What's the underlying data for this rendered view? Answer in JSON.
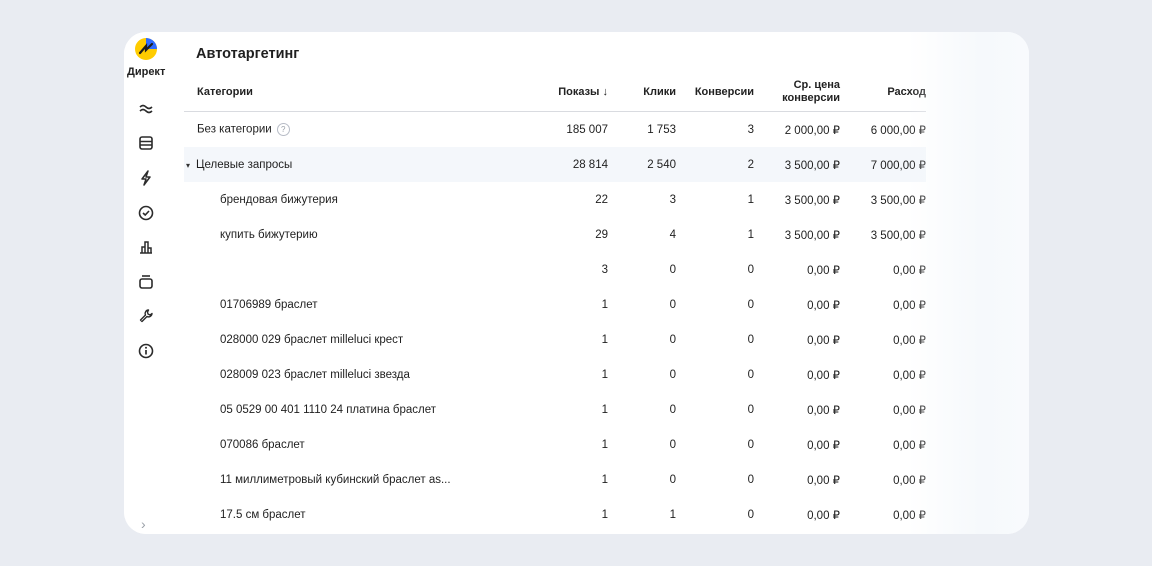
{
  "sidebar": {
    "brand": "Директ",
    "icons": [
      "waves-icon",
      "list-icon",
      "lightning-icon",
      "check-circle-icon",
      "bar-chart-icon",
      "archive-icon",
      "wrench-icon",
      "info-icon"
    ],
    "expand_glyph": "›"
  },
  "page": {
    "title": "Автотаргетинг"
  },
  "table": {
    "headers": {
      "name": "Категории",
      "shows": "Показы ↓",
      "clicks": "Клики",
      "conversions": "Конверсии",
      "cpa_line1": "Ср. цена",
      "cpa_line2": "конверсии",
      "cost": "Расход"
    },
    "rows": [
      {
        "name": "Без категории",
        "shows": "185 007",
        "clicks": "1 753",
        "conversions": "3",
        "cpa": "2 000,00 ₽",
        "cost": "6 000,00 ₽",
        "kind": "top",
        "help": "?"
      },
      {
        "name": "Целевые запросы",
        "shows": "28 814",
        "clicks": "2 540",
        "conversions": "2",
        "cpa": "3 500,00 ₽",
        "cost": "7 000,00 ₽",
        "kind": "group",
        "caret": "▾"
      },
      {
        "name": "брендовая бижутерия",
        "shows": "22",
        "clicks": "3",
        "conversions": "1",
        "cpa": "3 500,00 ₽",
        "cost": "3 500,00 ₽",
        "kind": "child"
      },
      {
        "name": "купить бижутерию",
        "shows": "29",
        "clicks": "4",
        "conversions": "1",
        "cpa": "3 500,00 ₽",
        "cost": "3 500,00 ₽",
        "kind": "child"
      },
      {
        "name": "",
        "shows": "3",
        "clicks": "0",
        "conversions": "0",
        "cpa": "0,00 ₽",
        "cost": "0,00 ₽",
        "kind": "child"
      },
      {
        "name": "01706989 браслет",
        "shows": "1",
        "clicks": "0",
        "conversions": "0",
        "cpa": "0,00 ₽",
        "cost": "0,00 ₽",
        "kind": "child"
      },
      {
        "name": "028000 029 браслет milleluci крест",
        "shows": "1",
        "clicks": "0",
        "conversions": "0",
        "cpa": "0,00 ₽",
        "cost": "0,00 ₽",
        "kind": "child"
      },
      {
        "name": "028009 023 браслет milleluci звезда",
        "shows": "1",
        "clicks": "0",
        "conversions": "0",
        "cpa": "0,00 ₽",
        "cost": "0,00 ₽",
        "kind": "child"
      },
      {
        "name": "05 0529 00 401 1110 24 платина браслет",
        "shows": "1",
        "clicks": "0",
        "conversions": "0",
        "cpa": "0,00 ₽",
        "cost": "0,00 ₽",
        "kind": "child"
      },
      {
        "name": "070086 браслет",
        "shows": "1",
        "clicks": "0",
        "conversions": "0",
        "cpa": "0,00 ₽",
        "cost": "0,00 ₽",
        "kind": "child"
      },
      {
        "name": "11 миллиметровый кубинский браслет as...",
        "shows": "1",
        "clicks": "0",
        "conversions": "0",
        "cpa": "0,00 ₽",
        "cost": "0,00 ₽",
        "kind": "child"
      },
      {
        "name": "17.5 см браслет",
        "shows": "1",
        "clicks": "1",
        "conversions": "0",
        "cpa": "0,00 ₽",
        "cost": "0,00 ₽",
        "kind": "child"
      }
    ]
  },
  "colors": {
    "background": "#e9ecf2",
    "card": "#ffffff",
    "group_row": "#f4f7fb",
    "logo_yellow": "#ffcc00",
    "logo_blue": "#2f6bff"
  }
}
